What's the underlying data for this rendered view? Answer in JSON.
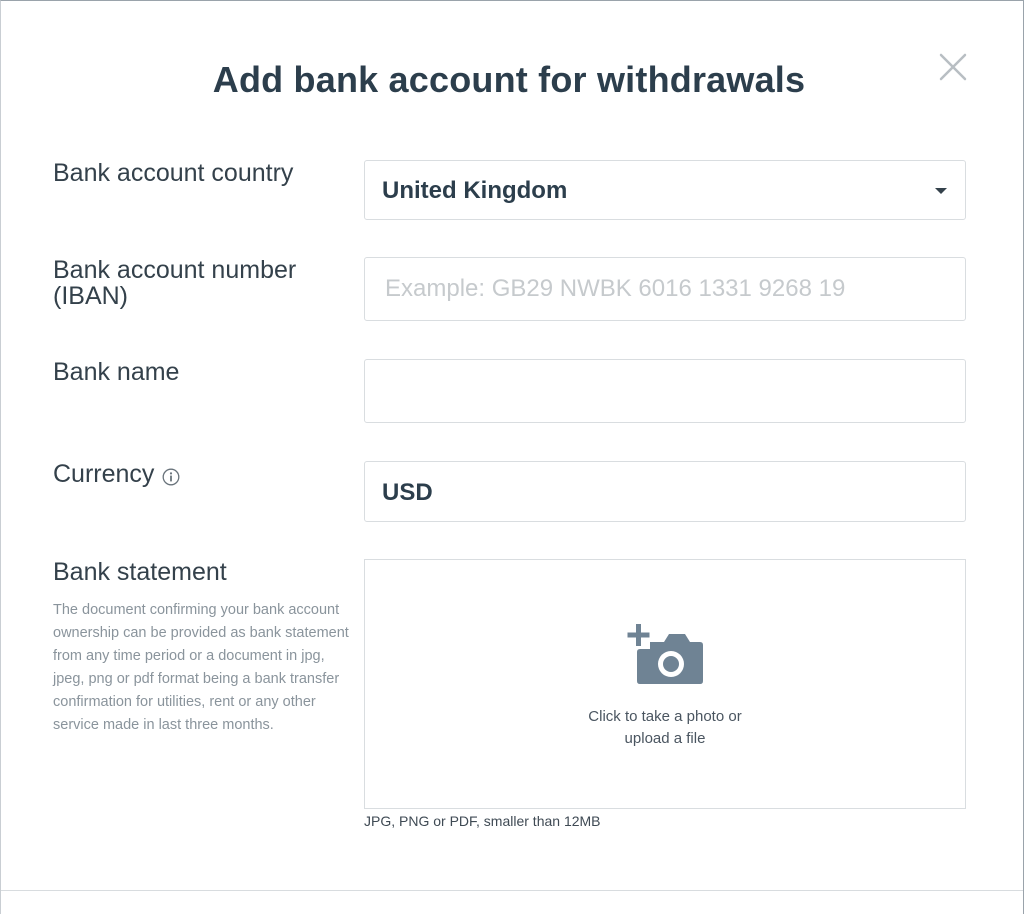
{
  "dialog": {
    "title": "Add bank account for withdrawals",
    "close_icon": "close-icon"
  },
  "form": {
    "country": {
      "label": "Bank account country",
      "value": "United Kingdom"
    },
    "iban": {
      "label_line1": "Bank account number",
      "label_line2": "(IBAN)",
      "value": "",
      "placeholder": "Example: GB29 NWBK 6016 1331 9268 19"
    },
    "bank_name": {
      "label": "Bank name",
      "value": ""
    },
    "currency": {
      "label": "Currency",
      "value": "USD",
      "info_icon": "info-icon"
    },
    "statement": {
      "label": "Bank statement",
      "description": "The document confirming your bank account ownership can be provided as bank statement from any time period or a document in jpg, jpeg, png or pdf format being a bank transfer confirmation for utilities, rent or any other service made in last three months.",
      "upload_icon": "add-photo-camera-icon",
      "upload_line1": "Click to take a photo or",
      "upload_line2": "upload a file",
      "hint": "JPG, PNG or PDF, smaller than 12MB"
    }
  },
  "colors": {
    "text": "#2c3e4c",
    "label": "#34414b",
    "muted": "#8a949c",
    "border": "#d9dde0",
    "icon": "#6f8394"
  }
}
